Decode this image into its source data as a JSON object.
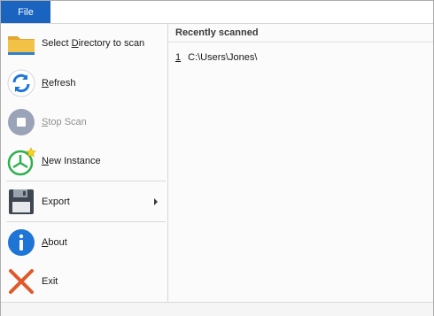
{
  "ribbon": {
    "file_tab": "File"
  },
  "menu": {
    "items": [
      {
        "pre": "Select ",
        "key": "D",
        "post": "irectory to scan",
        "icon": "folder-icon"
      },
      {
        "pre": "",
        "key": "R",
        "post": "efresh",
        "icon": "refresh-icon"
      },
      {
        "pre": "",
        "key": "S",
        "post": "top Scan",
        "icon": "stop-icon",
        "disabled": true
      },
      {
        "pre": "",
        "key": "N",
        "post": "ew Instance",
        "icon": "new-instance-icon"
      },
      {
        "pre": "",
        "key": "",
        "post": "Export",
        "icon": "floppy-disk-icon",
        "submenu": true
      },
      {
        "pre": "",
        "key": "A",
        "post": "bout",
        "icon": "info-icon"
      },
      {
        "pre": "",
        "key": "",
        "post": "Exit",
        "icon": "close-x-icon"
      }
    ]
  },
  "recent": {
    "title": "Recently scanned",
    "entries": [
      {
        "index": "1",
        "path": "C:\\Users\\Jones\\"
      }
    ]
  },
  "colors": {
    "file_tab": "#1a63bf",
    "folder": "#f2c246",
    "refresh": "#1f75d6",
    "stop_disabled": "#9aa3b8",
    "new_instance": "#2fb04e",
    "floppy": "#3e4652",
    "info": "#1f75d6",
    "exit": "#e0582a"
  }
}
